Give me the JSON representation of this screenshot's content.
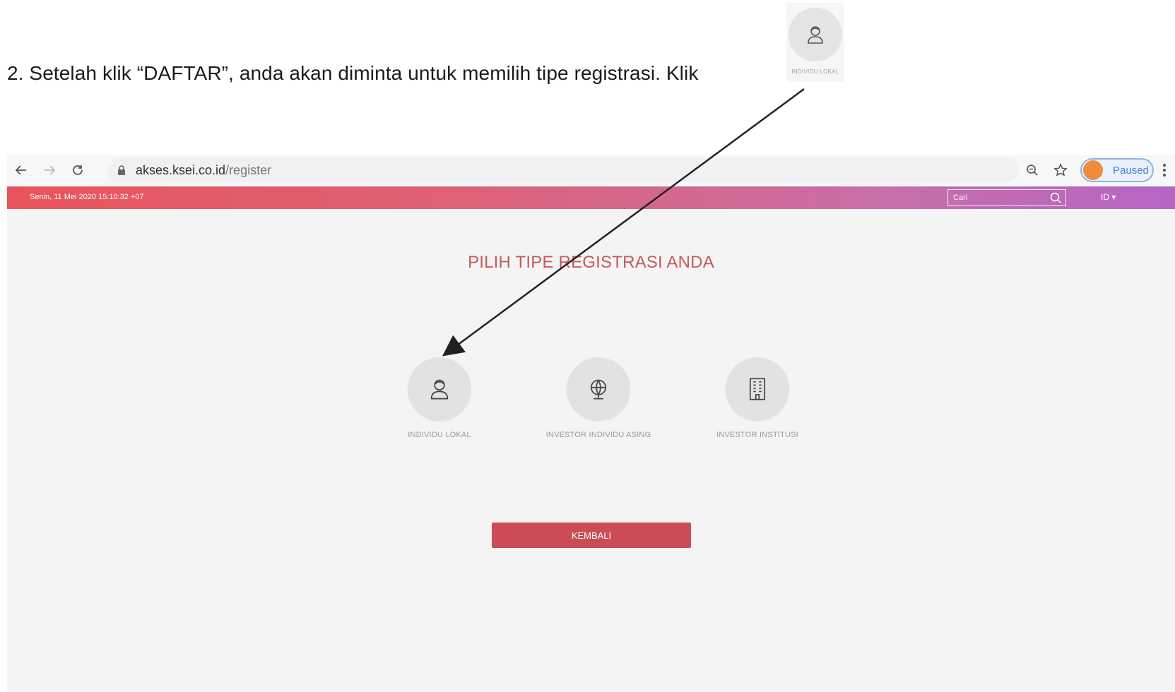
{
  "instruction": {
    "text": "2. Setelah klik “DAFTAR”, anda akan diminta untuk memilih tipe registrasi. Klik"
  },
  "callout": {
    "label": "INDIVIDU LOKAL",
    "icon": "person-icon"
  },
  "browser": {
    "url_host": "akses.ksei.co.id",
    "url_path": "/register",
    "profile_status": "Paused",
    "icons": [
      "back-arrow-icon",
      "forward-arrow-icon",
      "reload-icon",
      "lock-icon",
      "zoom-icon",
      "star-icon",
      "kebab-menu-icon"
    ]
  },
  "header": {
    "date": "Senin, 11 Mei 2020 15:10:32 +07",
    "search_placeholder": "Cari",
    "lang": "ID ▾"
  },
  "page": {
    "title": "PILIH TIPE REGISTRASI ANDA",
    "options": [
      {
        "label": "INDIVIDU LOKAL",
        "icon": "person-icon"
      },
      {
        "label": "INVESTOR INDIVIDU ASING",
        "icon": "globe-icon"
      },
      {
        "label": "INVESTOR INSTITUSI",
        "icon": "building-icon"
      }
    ],
    "back_button": "KEMBALI"
  },
  "colors": {
    "header_gradient_start": "#e8545a",
    "header_gradient_end": "#b565c6",
    "title": "#c45a5a",
    "button": "#cc4c55"
  }
}
